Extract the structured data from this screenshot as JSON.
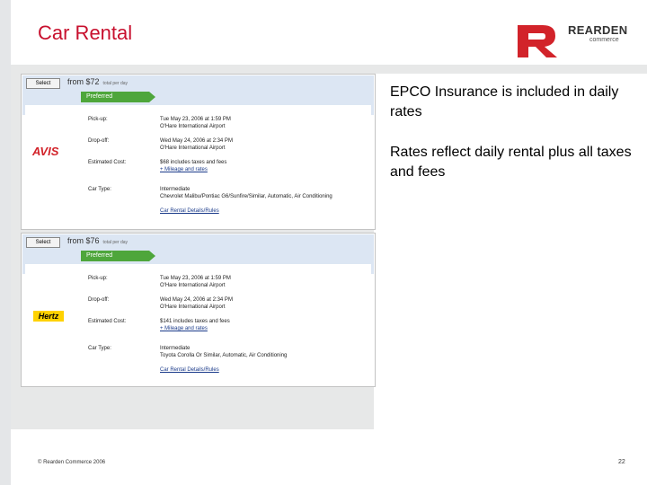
{
  "slide": {
    "title": "Car Rental",
    "logo": {
      "name": "REARDEN",
      "sub": "commerce"
    },
    "notes": [
      "EPCO Insurance is included in daily rates",
      "Rates reflect daily rental plus all taxes and fees"
    ],
    "footer": "© Rearden Commerce 2006",
    "page_number": "22",
    "colors": {
      "title_red": "#c8102e",
      "preferred_green": "#4ea63b",
      "avis_red": "#d2232a",
      "hertz_yellow": "#ffd200"
    }
  },
  "listings": [
    {
      "select": "Select",
      "price": "from $72",
      "price_suffix": "total per day",
      "preferred": "Preferred",
      "brand": "AVIS",
      "pickup_label": "Pick-up:",
      "pickup_value": "Tue May 23, 2006 at 1:59 PM",
      "pickup_place": "O'Hare International Airport",
      "dropoff_label": "Drop-off:",
      "dropoff_value": "Wed May 24, 2006 at 2:34 PM",
      "dropoff_place": "O'Hare International Airport",
      "cost_label": "Estimated Cost:",
      "cost_value": "$68 includes taxes and fees",
      "mileage_link": "+ Mileage and rates",
      "type_label": "Car Type:",
      "type_value": "Intermediate",
      "type_detail": "Chevrolet Malibu/Pontiac G6/Sunfire/Similar, Automatic, Air Conditioning",
      "details_link": "Car Rental Details/Rules"
    },
    {
      "select": "Select",
      "price": "from $76",
      "price_suffix": "total per day",
      "preferred": "Preferred",
      "brand": "Hertz",
      "pickup_label": "Pick-up:",
      "pickup_value": "Tue May 23, 2006 at 1:59 PM",
      "pickup_place": "O'Hare International Airport",
      "dropoff_label": "Drop-off:",
      "dropoff_value": "Wed May 24, 2006 at 2:34 PM",
      "dropoff_place": "O'Hare International Airport",
      "cost_label": "Estimated Cost:",
      "cost_value": "$141 includes taxes and fees",
      "mileage_link": "+ Mileage and rates",
      "type_label": "Car Type:",
      "type_value": "Intermediate",
      "type_detail": "Toyota Corolla Or Similar, Automatic, Air Conditioning",
      "details_link": "Car Rental Details/Rules"
    }
  ]
}
